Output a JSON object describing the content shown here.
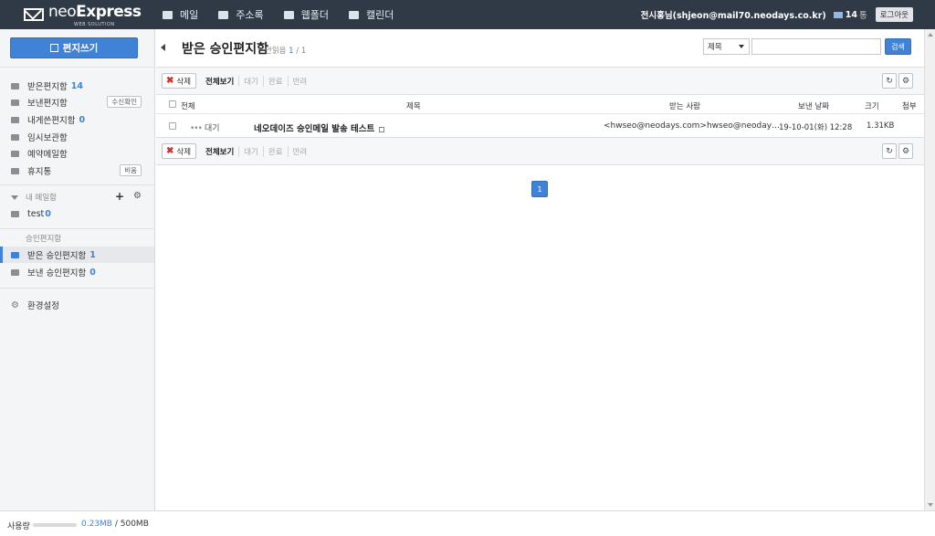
{
  "header": {
    "logo_main": "neo",
    "logo_bold": "Express",
    "logo_sub": "WEB SOLUTION",
    "nav": [
      {
        "label": "메일",
        "icon": "mail-icon"
      },
      {
        "label": "주소록",
        "icon": "address-book-icon"
      },
      {
        "label": "웹폴더",
        "icon": "web-folder-icon"
      },
      {
        "label": "캘린더",
        "icon": "calendar-icon"
      }
    ],
    "user": "전시홍님(shjeon@mail70.neodays.co.kr)",
    "mail_count": "14",
    "mail_unit": "통",
    "logout_label": "로그아웃"
  },
  "sidebar": {
    "compose_label": "편지쓰기",
    "folders": [
      {
        "label": "받은편지함",
        "count": "14"
      },
      {
        "label": "보낸편지함",
        "button": "수신확인"
      },
      {
        "label": "내게쓴편지함",
        "count": "0"
      },
      {
        "label": "임시보관함"
      },
      {
        "label": "예약메일함"
      },
      {
        "label": "휴지통",
        "button": "비움"
      }
    ],
    "my_mailbox_header": "내 메일함",
    "my_mailboxes": [
      {
        "label": "test",
        "count": "0"
      }
    ],
    "approval_header": "승인편지함",
    "approval_folders": [
      {
        "label": "받은 승인편지함",
        "count": "1"
      },
      {
        "label": "보낸 승인편지함",
        "count": "0"
      }
    ],
    "settings_label": "환경설정"
  },
  "main": {
    "title": "받은 승인편지함",
    "unread_label": "안읽음",
    "unread_count": "1",
    "total_count": "/ 1",
    "search": {
      "field_selected": "제목",
      "query": "",
      "button_label": "검색"
    },
    "toolbar": {
      "delete_label": "삭제",
      "filters": [
        "전체보기",
        "대기",
        "완료",
        "반려"
      ]
    },
    "columns": {
      "all": "전체",
      "subject": "제목",
      "recipient": "받는 사람",
      "date": "보낸 날짜",
      "size": "크기",
      "attachment": "첨부"
    },
    "rows": [
      {
        "status": "대기",
        "subject": "네오데이즈 승인메일 발송 테스트",
        "recipient": "<hwseo@neodays.com>hwseo@neoday…",
        "date": "19-10-01(화) 12:28",
        "size": "1.31KB"
      }
    ],
    "pagination": {
      "current": "1"
    }
  },
  "footer": {
    "usage_label": "사용량",
    "used": "0.23MB",
    "total": "/ 500MB",
    "usage_fraction": 0.0005
  },
  "colors": {
    "header_bg": "#2f3a46",
    "accent": "#3f82d6",
    "sidebar_bg": "#f4f5f7"
  }
}
